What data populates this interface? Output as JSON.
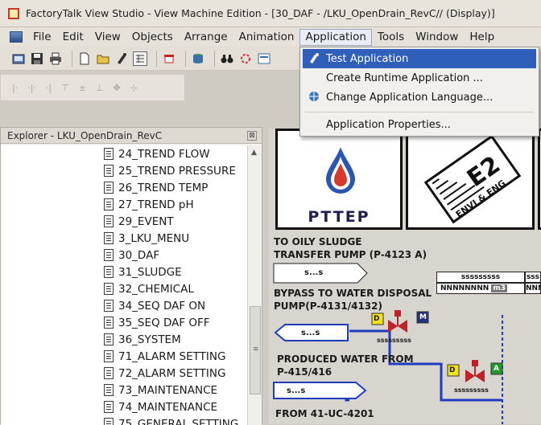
{
  "window": {
    "title": "FactoryTalk View Studio - View Machine Edition - [30_DAF - /LKU_OpenDrain_RevC// (Display)]"
  },
  "menu": {
    "items": [
      "File",
      "Edit",
      "View",
      "Objects",
      "Arrange",
      "Animation",
      "Application",
      "Tools",
      "Window",
      "Help"
    ],
    "active": "Application"
  },
  "application_menu": {
    "items": [
      {
        "label": "Test Application",
        "icon": "test-run-icon",
        "highlighted": true
      },
      {
        "label": "Create Runtime Application ...",
        "icon": "",
        "highlighted": false
      },
      {
        "label": "Change Application Language...",
        "icon": "language-icon",
        "highlighted": false
      },
      {
        "label": "Application Properties...",
        "icon": "",
        "highlighted": false
      }
    ]
  },
  "explorer": {
    "title": "Explorer - LKU_OpenDrain_RevC",
    "items": [
      "24_TREND FLOW",
      "25_TREND PRESSURE",
      "26_TREND TEMP",
      "27_TREND pH",
      "29_EVENT",
      "3_LKU_MENU",
      "30_DAF",
      "31_SLUDGE",
      "32_CHEMICAL",
      "34_SEQ DAF ON",
      "35_SEQ DAF OFF",
      "36_SYSTEM",
      "71_ALARM SETTING",
      "72_ALARM SETTING",
      "73_MAINTENANCE",
      "74_MAINTENANCE",
      "75_GENERAL SETTING"
    ]
  },
  "display": {
    "logo1_text": "PTTEP",
    "logo2_text": "ENVI & ENG",
    "label_sludge_1": "TO OILY SLUDGE",
    "label_sludge_2": "TRANSFER PUMP (P-4123 A)",
    "tag_s1": "s...s",
    "label_bypass_1": "BYPASS TO WATER DISPOSAL",
    "label_bypass_2": "PUMP(P-4131/4132)",
    "tag_s2": "s...s",
    "label_produced_1": "PRODUCED WATER FROM",
    "label_produced_2": "P-415/416",
    "tag_s3": "s...s",
    "label_from": "FROM 41-UC-4201",
    "readout_1": "sssssssss",
    "readout_1_value": "NNNNNNNN",
    "readout_1_unit": "m3",
    "readout_2": "sss",
    "readout_2_value": "NNN",
    "valve_1_badge_d": "D",
    "valve_1_badge_m": "M",
    "valve_1_tag": "sssssssss",
    "valve_2_badge_d": "D",
    "valve_2_badge_a": "A",
    "valve_2_tag": "sssssssss"
  },
  "colors": {
    "highlight": "#2f5fb8",
    "pipe_blue": "#1f3cc0",
    "badge_yellow": "#f3e21a",
    "badge_green": "#1f9a2a",
    "badge_navy": "#25307a",
    "valve_red": "#c0222a"
  }
}
